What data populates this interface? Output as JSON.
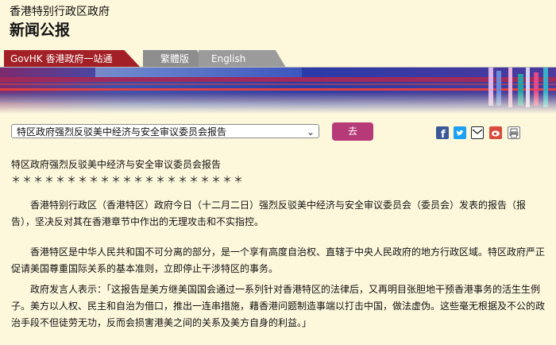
{
  "header": {
    "gov_name": "香港特别行政区政府",
    "section_title": "新闻公报"
  },
  "nav": {
    "govhk_label": "GovHK 香港政府一站通",
    "traditional_label": "繁體版",
    "english_label": "English"
  },
  "toolbar": {
    "select_value": "特区政府强烈反驳美中经济与安全审议委员会报告",
    "go_label": "去"
  },
  "share_icons": [
    "facebook-icon",
    "twitter-icon",
    "email-icon",
    "weibo-icon",
    "print-icon"
  ],
  "colors": {
    "background": "#fdf8dc",
    "govhk_tab": "#a32126",
    "go_button": "#b73a78",
    "facebook": "#3b5998",
    "twitter": "#1da1f2"
  },
  "article": {
    "title": "特区政府强烈反驳美中经济与安全审议委员会报告",
    "separator": "＊＊＊＊＊＊＊＊＊＊＊＊＊＊＊＊＊＊＊＊＊",
    "paragraphs": [
      "香港特别行政区（香港特区）政府今日（十二月二日）强烈反驳美中经济与安全审议委员会（委员会）发表的报告（报告），坚决反对其在香港章节中作出的无理攻击和不实指控。",
      "香港特区是中华人民共和国不可分离的部分，是一个享有高度自治权、直辖于中央人民政府的地方行政区域。特区政府严正促请美国尊重国际关系的基本准则，立即停止干涉特区的事务。",
      "政府发言人表示：「这报告是美方继美国国会通过一系列针对香港特区的法律后，又再明目张胆地干预香港事务的活生生例子。美方以人权、民主和自治为借口，推出一连串措施，藉香港问题制造事端以打击中国，做法虚伪。这些毫无根据及不公的政治手段不但徒劳无功，反而会损害港美之间的关系及美方自身的利益。」"
    ]
  }
}
